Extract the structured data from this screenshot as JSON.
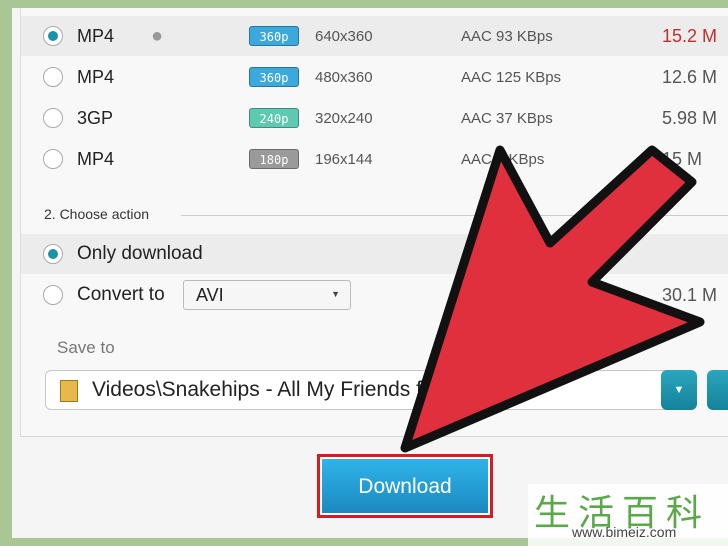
{
  "formats": [
    {
      "format": "MP4",
      "apple": true,
      "quality": "360p",
      "quality_color": "#3ba9dc",
      "resolution": "640x360",
      "audio": "AAC 93  KBps",
      "size": "15.2 M",
      "size_color": "#c0302a",
      "selected": true
    },
    {
      "format": "MP4",
      "apple": false,
      "quality": "360p",
      "quality_color": "#3ba9dc",
      "resolution": "480x360",
      "audio": "AAC 125  KBps",
      "size": "12.6 M",
      "selected": false
    },
    {
      "format": "3GP",
      "apple": false,
      "quality": "240p",
      "quality_color": "#5ec9b1",
      "resolution": "320x240",
      "audio": "AAC 37  KBps",
      "size": "5.98 M",
      "selected": false
    },
    {
      "format": "MP4",
      "apple": false,
      "quality": "180p",
      "quality_color": "#9a9a9a",
      "resolution": "196x144",
      "audio": "AAC 1  KBps",
      "size": "15 M",
      "selected": false
    }
  ],
  "action": {
    "section_title": "2. Choose action",
    "only_download": "Only download",
    "convert_to": "Convert to",
    "convert_format": "AVI",
    "convert_size": "30.1 M",
    "selected": "only_download"
  },
  "save": {
    "label": "Save to",
    "path": "Videos\\Snakehips - All My Friends f"
  },
  "download_label": "Download",
  "watermark": {
    "chinese": "生活百科",
    "url": "www.bimeiz.com"
  },
  "colors": {
    "accent": "#1a93a8",
    "arrow": "#e0303e",
    "highlight": "#d51c24"
  }
}
